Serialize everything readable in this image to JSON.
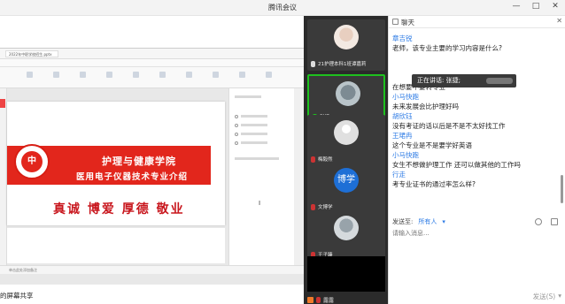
{
  "window": {
    "title": "腾讯会议",
    "controls": [
      "—",
      "□",
      "✕"
    ]
  },
  "share": {
    "file_tab": "2022年中职学校招生.pptx",
    "status_text": "单击此处添加备注",
    "slide": {
      "logo_text": "中",
      "line1": "护理与健康学院",
      "line2": "医用电子仪器技术专业介绍",
      "motto": "真诚  博爱  厚德  敬业"
    },
    "label": "的屏幕共享"
  },
  "participants": [
    {
      "name": "21护理本科1班谭嘉莉",
      "avatar": "photo"
    },
    {
      "name": "张捷",
      "avatar": "photo"
    },
    {
      "name": "梅毅然",
      "avatar": "default"
    },
    {
      "name": "文博学",
      "avatar_text": "博学"
    },
    {
      "name": "王子臻",
      "avatar": "photo"
    }
  ],
  "self_tile": {
    "name": "露露"
  },
  "chat": {
    "title": "聊天",
    "close": "✕",
    "messages": [
      {
        "name": "章吉锐",
        "text": "老师，该专业主要的学习内容是什么?"
      },
      {
        "name": "",
        "text": ""
      },
      {
        "name": "",
        "text": ""
      },
      {
        "name": "",
        "text": "在想要不要转专业"
      },
      {
        "name": "小马快跑",
        "text": "未来发展会比护理好吗"
      },
      {
        "name": "胡欣钰",
        "text": "没有考证的话以后是不是不太好找工作"
      },
      {
        "name": "王珺冉",
        "text": "这个专业是不是要学好英语"
      },
      {
        "name": "小马快跑",
        "text": "女生不想做护理工作 还可以做其他的工作吗"
      },
      {
        "name": "行走",
        "text": "考专业证书的通过率怎么样?"
      }
    ],
    "speaking": "正在讲话: 张捷;",
    "send_to_label": "发送至:",
    "send_to_value": "所有人",
    "input_placeholder": "请输入消息...",
    "send_label": "发送(S)",
    "send_arrow": "▾"
  }
}
